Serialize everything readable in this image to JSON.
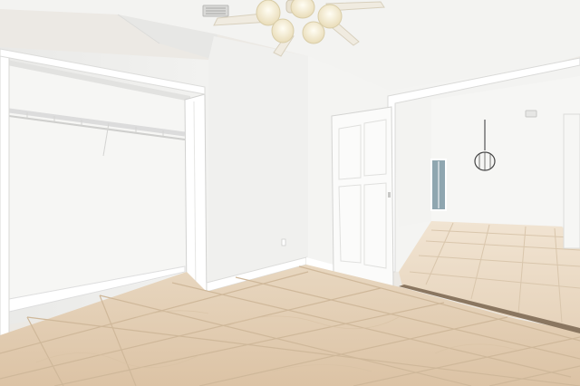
{
  "scene": {
    "kind": "photo",
    "subject": "vacant-room-interior",
    "colors": {
      "wall": "#f1f1ef",
      "ceiling": "#f4f4f2",
      "trim": "#ffffff",
      "floor_tile": "#e3cfb5",
      "floor_grout": "#d2bca0",
      "next_room_floor": "#ecdcc6",
      "window_glass": "#8fa6b0",
      "fan_glass": "#f7efd5"
    }
  }
}
